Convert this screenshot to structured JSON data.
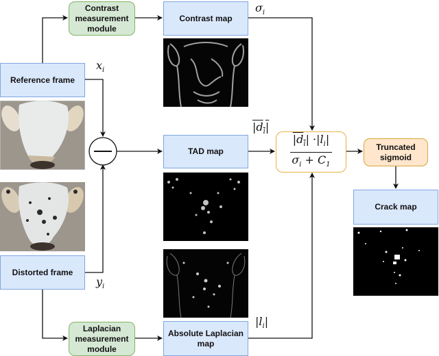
{
  "nodes": {
    "contrast_module": "Contrast measurement module",
    "contrast_map": "Contrast map",
    "reference_frame": "Reference frame",
    "distorted_frame": "Distorted frame",
    "tad_map": "TAD map",
    "laplacian_module": "Laplacian measurement module",
    "abs_laplacian_map": "Absolute Laplacian map",
    "truncated_sigmoid": "Truncated sigmoid",
    "crack_map": "Crack map",
    "subtract_operator": "−"
  },
  "symbols": {
    "x": "x",
    "x_sub": "i",
    "y": "y",
    "y_sub": "i",
    "sigma": "σ",
    "sigma_sub": "i",
    "d_abs": "|d",
    "d_sub": "i",
    "d_close": "|",
    "l_abs": "|l",
    "l_sub": "i",
    "l_close": "|"
  },
  "formula": {
    "numerator_d": "|d",
    "numerator_d_sub": "i",
    "numerator_mid": "| ·|l",
    "numerator_l_sub": "i",
    "numerator_end": "|",
    "denominator_sigma": "σ",
    "denominator_sigma_sub": "i",
    "denominator_plus": " + C",
    "denominator_c_sub": "1"
  },
  "images": {
    "reference": "reference-goat-render",
    "distorted": "distorted-goat-render",
    "contrast": "contrast-map-image",
    "tad": "tad-map-image",
    "laplacian": "laplacian-map-image",
    "crack": "crack-map-image"
  },
  "colors": {
    "blue_fill": "#dae8fc",
    "blue_stroke": "#7ea6e0",
    "green_fill": "#d5e8d4",
    "green_stroke": "#82b366",
    "orange_fill": "#ffe6cc",
    "orange_stroke": "#d6a63a",
    "formula_stroke": "#e3b341"
  }
}
